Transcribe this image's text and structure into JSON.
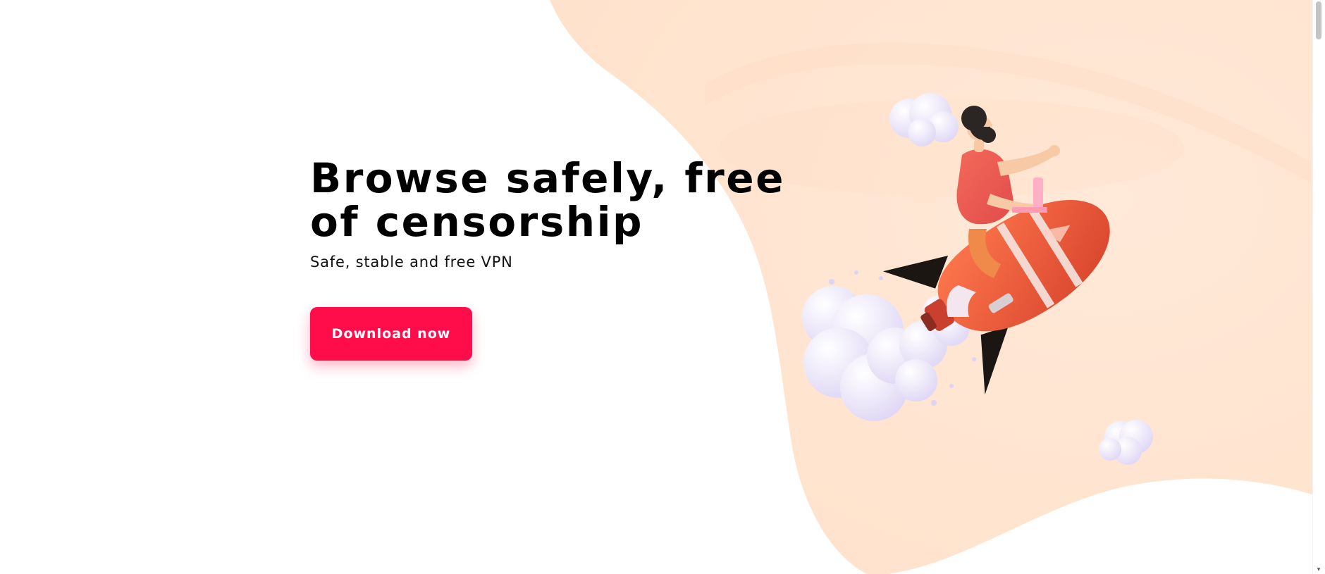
{
  "hero": {
    "headline": "Browse safely, free of censorship",
    "subtitle": "Safe, stable and free VPN",
    "cta_label": "Download now"
  },
  "illustration": {
    "subject": "woman-riding-rocket-icon",
    "elements": [
      "rocket-icon",
      "person-icon",
      "laptop-icon",
      "cloud-icon",
      "smoke-cloud-icon"
    ]
  },
  "colors": {
    "accent": "#ff0d4b",
    "background_blob": "#ffe6d4",
    "rocket": "#ef5a3a",
    "fin": "#1b1612",
    "headline": "#000000",
    "page": "#ffffff"
  }
}
